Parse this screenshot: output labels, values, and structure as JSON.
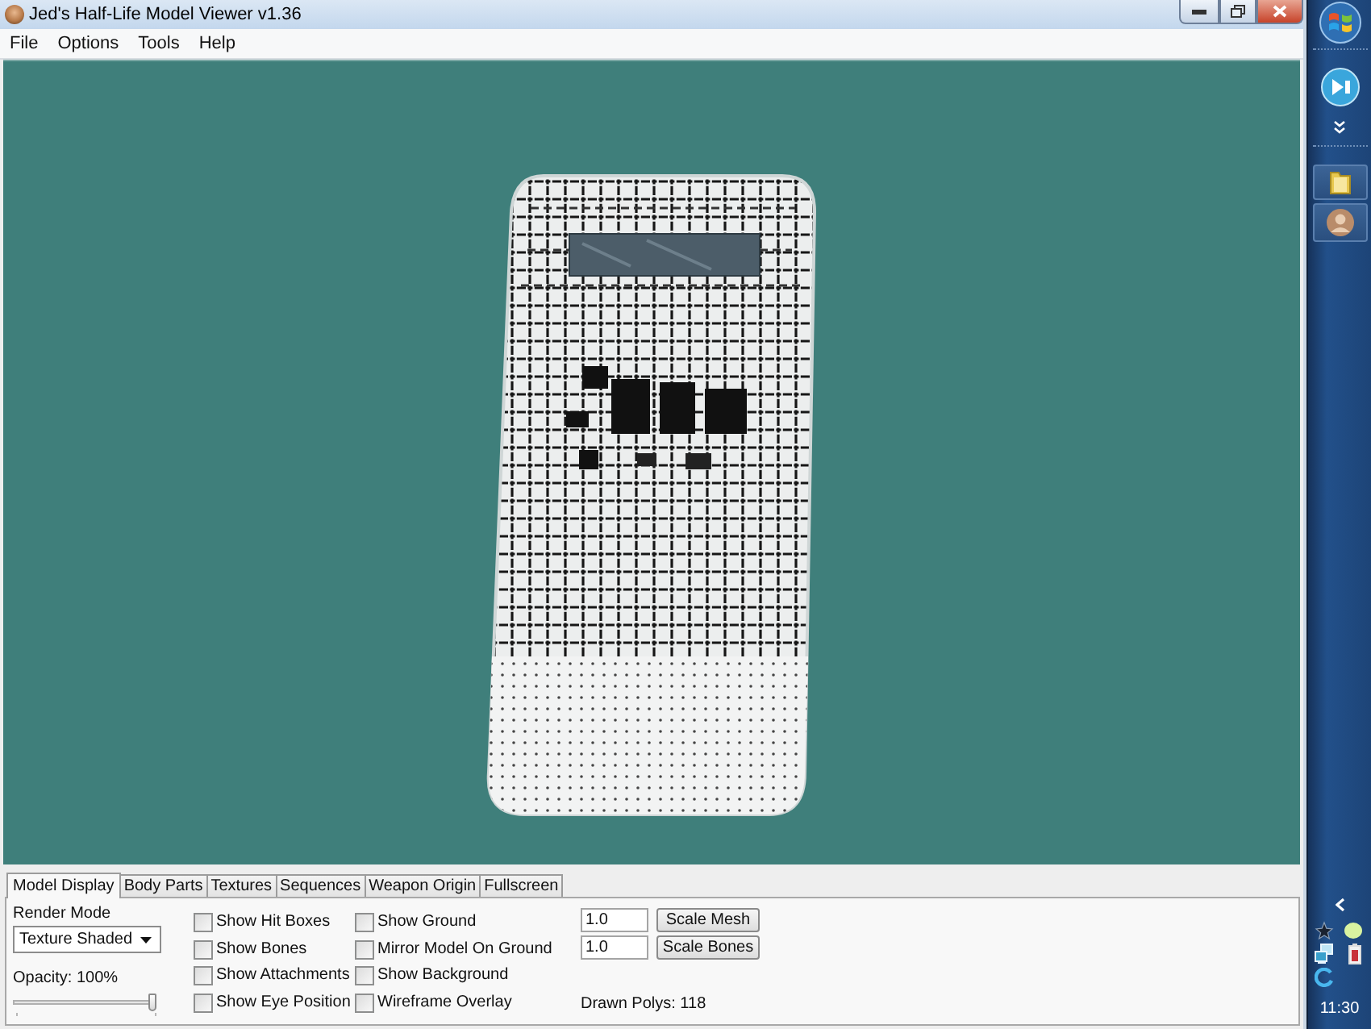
{
  "window": {
    "title": "Jed's Half-Life Model Viewer v1.36"
  },
  "menu": [
    "File",
    "Options",
    "Tools",
    "Help"
  ],
  "tabs": [
    {
      "label": "Model Display",
      "selected": true
    },
    {
      "label": "Body Parts",
      "selected": false
    },
    {
      "label": "Textures",
      "selected": false
    },
    {
      "label": "Sequences",
      "selected": false
    },
    {
      "label": "Weapon Origin",
      "selected": false
    },
    {
      "label": "Fullscreen",
      "selected": false
    }
  ],
  "model_display": {
    "render_mode": {
      "label": "Render Mode",
      "value": "Texture Shaded"
    },
    "opacity": {
      "label": "Opacity: 100%",
      "level": 1
    },
    "checkboxes": [
      {
        "label": "Show Hit Boxes",
        "checked": false
      },
      {
        "label": "Show Bones",
        "checked": false
      },
      {
        "label": "Show Attachments",
        "checked": false
      },
      {
        "label": "Show Eye Position",
        "checked": false
      },
      {
        "label": "Show Ground",
        "checked": false
      },
      {
        "label": "Mirror Model On Ground",
        "checked": false
      },
      {
        "label": "Show Background",
        "checked": false
      },
      {
        "label": "Wireframe Overlay",
        "checked": false
      }
    ],
    "scales": [
      {
        "value": "1.0",
        "button": "Scale Mesh"
      },
      {
        "value": "1.0",
        "button": "Scale Bones"
      }
    ],
    "drawn_polys": "Drawn Polys: 118"
  },
  "taskbar": {
    "apps": [
      {
        "kind": "media"
      },
      {
        "kind": "folder"
      },
      {
        "kind": "user"
      }
    ],
    "clock": "11:30"
  }
}
